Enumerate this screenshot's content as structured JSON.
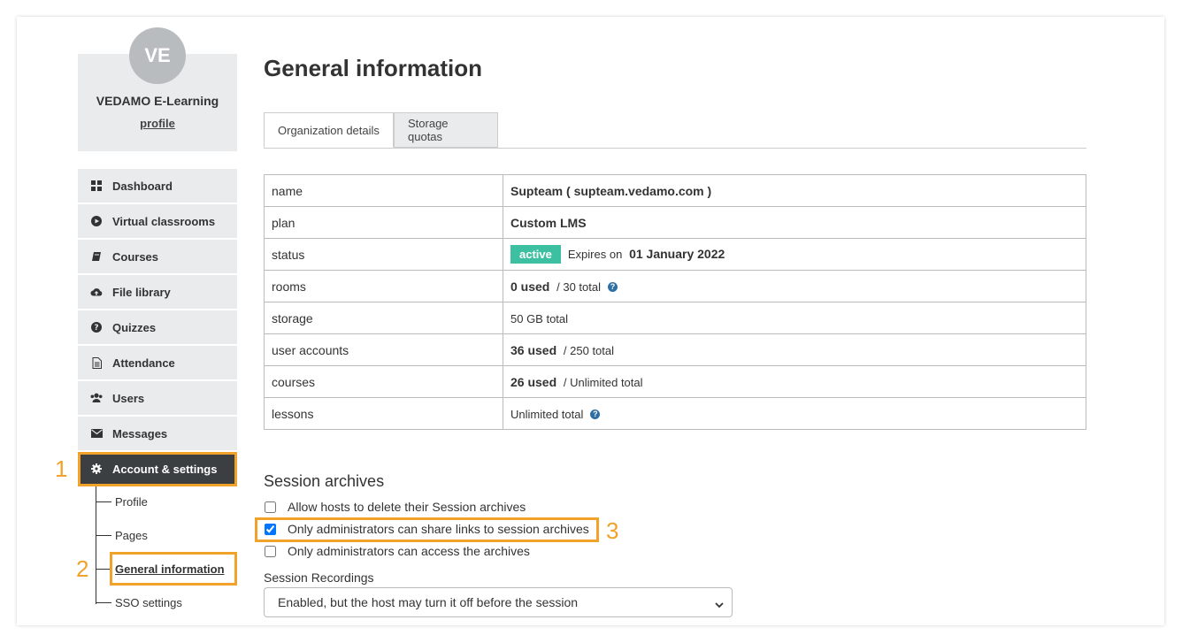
{
  "profile": {
    "initials": "VE",
    "org_name": "VEDAMO E-Learning",
    "link": "profile"
  },
  "nav": [
    {
      "label": "Dashboard",
      "icon": "dashboard-icon"
    },
    {
      "label": "Virtual classrooms",
      "icon": "play-circle-icon"
    },
    {
      "label": "Courses",
      "icon": "book-icon"
    },
    {
      "label": "File library",
      "icon": "cloud-upload-icon"
    },
    {
      "label": "Quizzes",
      "icon": "question-circle-icon"
    },
    {
      "label": "Attendance",
      "icon": "document-icon"
    },
    {
      "label": "Users",
      "icon": "users-icon"
    },
    {
      "label": "Messages",
      "icon": "envelope-icon"
    },
    {
      "label": "Account & settings",
      "icon": "gear-icon",
      "active": true
    }
  ],
  "subnav": [
    "Profile",
    "Pages",
    "General information",
    "SSO settings"
  ],
  "steps": [
    "1",
    "2",
    "3"
  ],
  "page": {
    "title": "General information"
  },
  "tabs": [
    "Organization details",
    "Storage quotas"
  ],
  "info": {
    "name": {
      "key": "name",
      "value": "Supteam ( supteam.vedamo.com )"
    },
    "plan": {
      "key": "plan",
      "value": "Custom LMS"
    },
    "status": {
      "key": "status",
      "badge": "active",
      "expires_label": "Expires on",
      "expires_date": "01 January 2022"
    },
    "rooms": {
      "key": "rooms",
      "used": "0 used",
      "total": "/ 30 total"
    },
    "storage": {
      "key": "storage",
      "total": "50 GB total"
    },
    "user_accounts": {
      "key": "user accounts",
      "used": "36 used",
      "total": "/ 250 total"
    },
    "courses": {
      "key": "courses",
      "used": "26 used",
      "total": "/ Unlimited total"
    },
    "lessons": {
      "key": "lessons",
      "total": "Unlimited total"
    }
  },
  "session_archives": {
    "title": "Session archives",
    "options": [
      {
        "label": "Allow hosts to delete their Session archives",
        "checked": false
      },
      {
        "label": "Only administrators can share links to session archives",
        "checked": true
      },
      {
        "label": "Only administrators can access the archives",
        "checked": false
      }
    ],
    "recordings_label": "Session Recordings",
    "recordings_value": "Enabled, but the host may turn it off before the session"
  },
  "colors": {
    "accent_highlight": "#f0a22a",
    "active_badge": "#3dbfa1",
    "nav_active": "#3b3f42",
    "info_icon": "#2d6fa3"
  }
}
